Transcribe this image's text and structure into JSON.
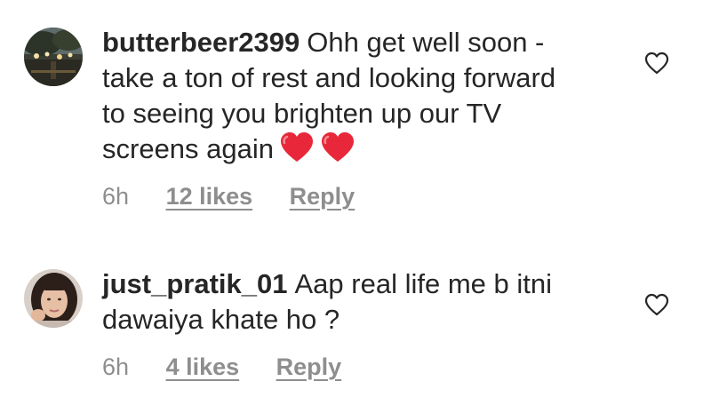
{
  "comments": [
    {
      "username": "butterbeer2399",
      "text": "Ohh get well soon - take a ton of rest and looking forward to seeing you brighten up our TV screens again",
      "emoji_count": 2,
      "emoji": "red-heart",
      "time": "6h",
      "likes": "12 likes",
      "reply": "Reply",
      "avatar": "night-garden-lights-avatar"
    },
    {
      "username": "just_pratik_01",
      "text": "Aap real life me b itni dawaiya khate ho ?",
      "time": "6h",
      "likes": "4 likes",
      "reply": "Reply",
      "avatar": "woman-portrait-avatar"
    }
  ],
  "colors": {
    "text": "#262626",
    "meta": "#8e8e8e",
    "heart_emoji": "#e8283a",
    "like_icon": "#262626"
  }
}
